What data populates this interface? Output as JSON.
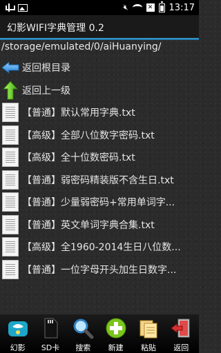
{
  "statusbar": {
    "time": "13:17"
  },
  "app": {
    "title": "幻影WIFI字典管理 0.2"
  },
  "path": "/storage/emulated/0/aiHuanying/",
  "nav": [
    {
      "label": "返回根目录",
      "icon": "arrow-left-icon"
    },
    {
      "label": "返回上一级",
      "icon": "arrow-up-icon"
    }
  ],
  "files": [
    {
      "label": "【普通】默认常用字典.txt"
    },
    {
      "label": "【高级】全部八位数字密码.txt"
    },
    {
      "label": "【高级】全十位数密码.txt"
    },
    {
      "label": "【普通】弱密码精装版不含生日.txt"
    },
    {
      "label": "【普通】少量弱密码+常用单词字..."
    },
    {
      "label": "【普通】英文单词字典合集.txt"
    },
    {
      "label": "【高级】全1960-2014生日八位数..."
    },
    {
      "label": "【普通】一位字母开头加生日数字..."
    }
  ],
  "toolbar": [
    {
      "label": "幻影",
      "icon": "app-icon"
    },
    {
      "label": "SD卡",
      "icon": "sdcard-icon"
    },
    {
      "label": "搜索",
      "icon": "search-icon"
    },
    {
      "label": "新建",
      "icon": "add-icon"
    },
    {
      "label": "粘贴",
      "icon": "paste-icon"
    },
    {
      "label": "返回",
      "icon": "exit-icon"
    }
  ],
  "colors": {
    "accent": "#3aa3d8",
    "add": "#7cc51c"
  }
}
